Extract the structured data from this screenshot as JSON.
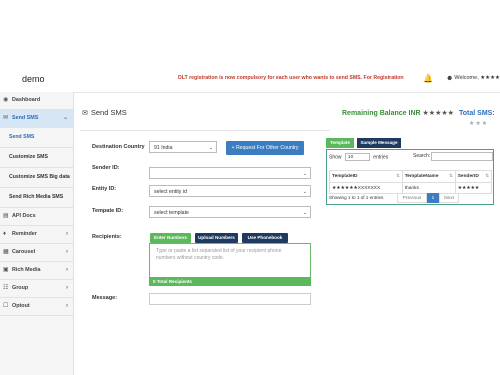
{
  "header": {
    "brand": "demo",
    "notice": "DLT registration is now compulsory for each user who wants to send SMS. For Registration",
    "welcome": "Welcome, ★★★★"
  },
  "sidebar": {
    "items": [
      {
        "label": "Dashboard",
        "icon": "dashboard-icon"
      },
      {
        "label": "Send SMS",
        "icon": "send-sms-icon",
        "active": true
      },
      {
        "label": "Send SMS"
      },
      {
        "label": "Customize SMS"
      },
      {
        "label": "Customize SMS Big data"
      },
      {
        "label": "Send Rich Media SMS"
      },
      {
        "label": "API Docs",
        "icon": "api-docs-icon"
      },
      {
        "label": "Reminder",
        "icon": "reminder-icon"
      },
      {
        "label": "Carousel",
        "icon": "carousel-icon"
      },
      {
        "label": "Rich Media",
        "icon": "rich-media-icon"
      },
      {
        "label": "Group",
        "icon": "group-icon"
      },
      {
        "label": "Optout",
        "icon": "optout-icon"
      }
    ]
  },
  "main": {
    "title": "Send SMS",
    "balance_label": "Remaining Balance INR",
    "balance_value": "★★★★★",
    "total_sms_label": "Total SMS:",
    "total_sms_value": "★★★",
    "form": {
      "destination_label": "Destination Country",
      "destination_value": "91 India",
      "request_button": "+ Request For Other Country",
      "sender_label": "Sender ID:",
      "sender_value": "",
      "entity_label": "Entity ID:",
      "entity_value": "select entity id",
      "template_label": "Tempate ID:",
      "template_value": "select template",
      "recipients_label": "Recipients:",
      "tab_enter": "Enter Numbers",
      "tab_upload": "Upload Numbers",
      "tab_phonebook": "Use Phonebook",
      "recipients_placeholder": "Type or paste a list separated list of your recipient phone numbers without country code.",
      "total_recipients": "0 Total Recipients",
      "message_label": "Message:"
    },
    "template_panel": {
      "tab_template": "Template",
      "tab_sample": "Sample Message",
      "show_label": "Show",
      "show_value": "10",
      "entries_label": "entries",
      "search_label": "Search:",
      "columns": [
        "TemplateID",
        "TemplateName",
        "SenderID"
      ],
      "rows": [
        [
          "★★★★★★XXXXXXX",
          "thanks",
          "★★★★★"
        ]
      ],
      "showing": "Showing 1 to 1 of 1 entries",
      "prev": "Previous",
      "page": "1",
      "next": "Next"
    }
  }
}
